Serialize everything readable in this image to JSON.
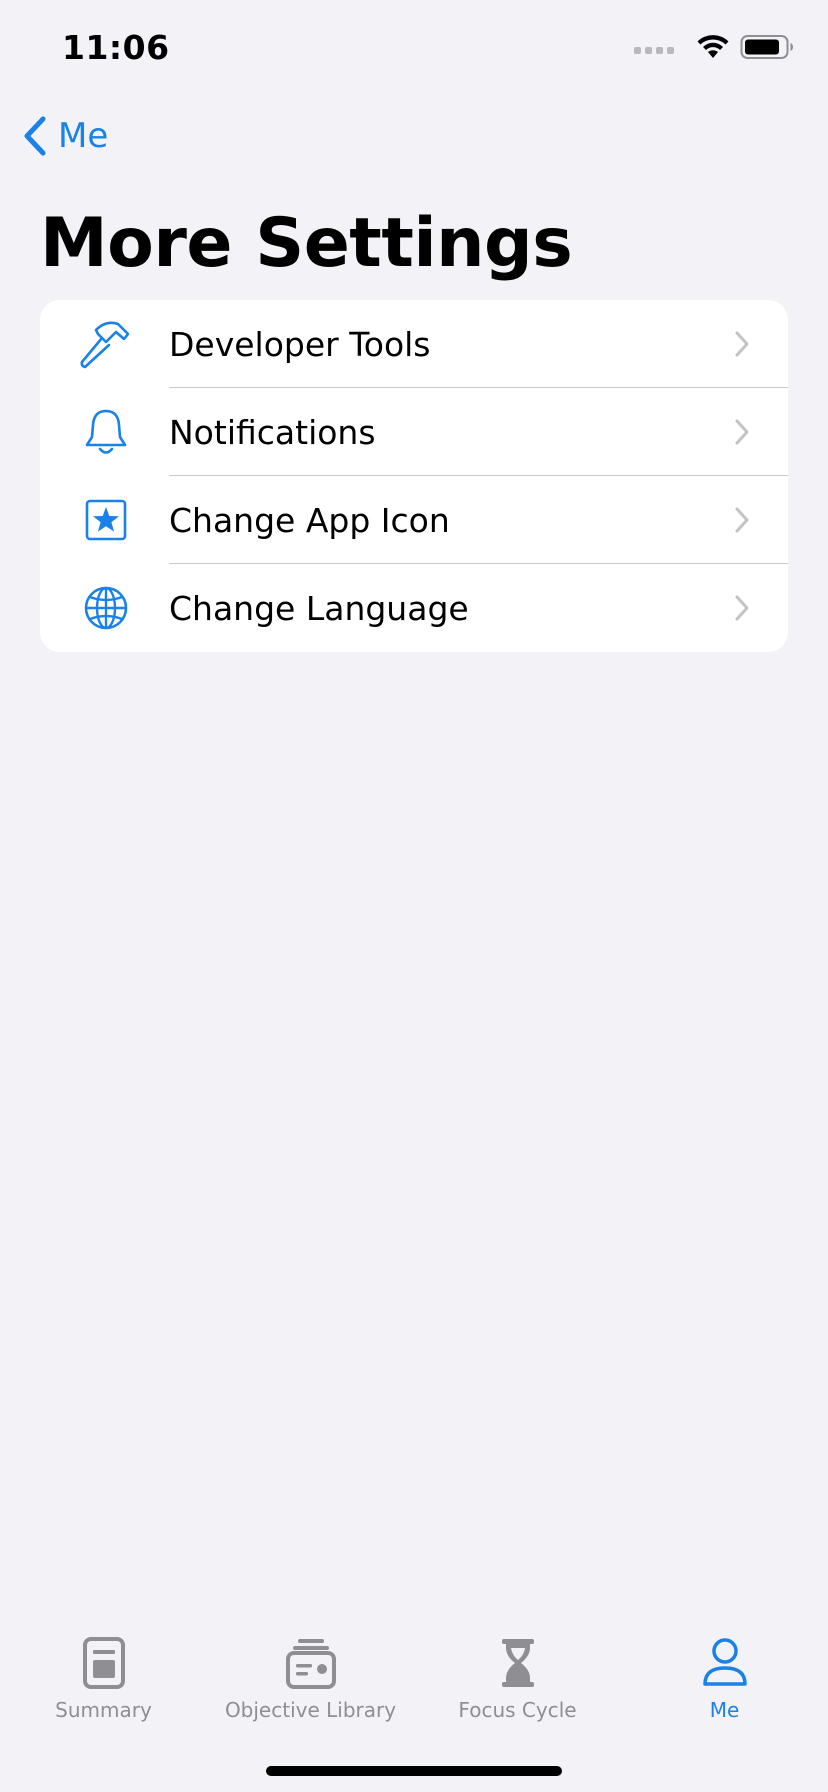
{
  "status_bar": {
    "time": "11:06",
    "icons": [
      "cellular-dots-icon",
      "wifi-icon",
      "battery-icon"
    ]
  },
  "nav": {
    "back_label": "Me",
    "back_icon": "chevron-left-icon"
  },
  "page": {
    "title": "More Settings"
  },
  "settings": {
    "items": [
      {
        "label": "Developer Tools",
        "icon": "hammer-icon"
      },
      {
        "label": "Notifications",
        "icon": "bell-icon"
      },
      {
        "label": "Change App Icon",
        "icon": "star-square-icon"
      },
      {
        "label": "Change Language",
        "icon": "globe-icon"
      }
    ]
  },
  "tab_bar": {
    "tabs": [
      {
        "label": "Summary",
        "icon": "summary-document-icon",
        "active": false
      },
      {
        "label": "Objective Library",
        "icon": "library-archive-icon",
        "active": false
      },
      {
        "label": "Focus Cycle",
        "icon": "hourglass-icon",
        "active": false
      },
      {
        "label": "Me",
        "icon": "person-icon",
        "active": true
      }
    ]
  },
  "colors": {
    "accent": "#1a82e6",
    "background": "#f2f2f7",
    "card": "#ffffff",
    "inactive_tab": "#8e8e93",
    "separator": "#c8c8cc",
    "chevron": "#c4c4c7"
  }
}
